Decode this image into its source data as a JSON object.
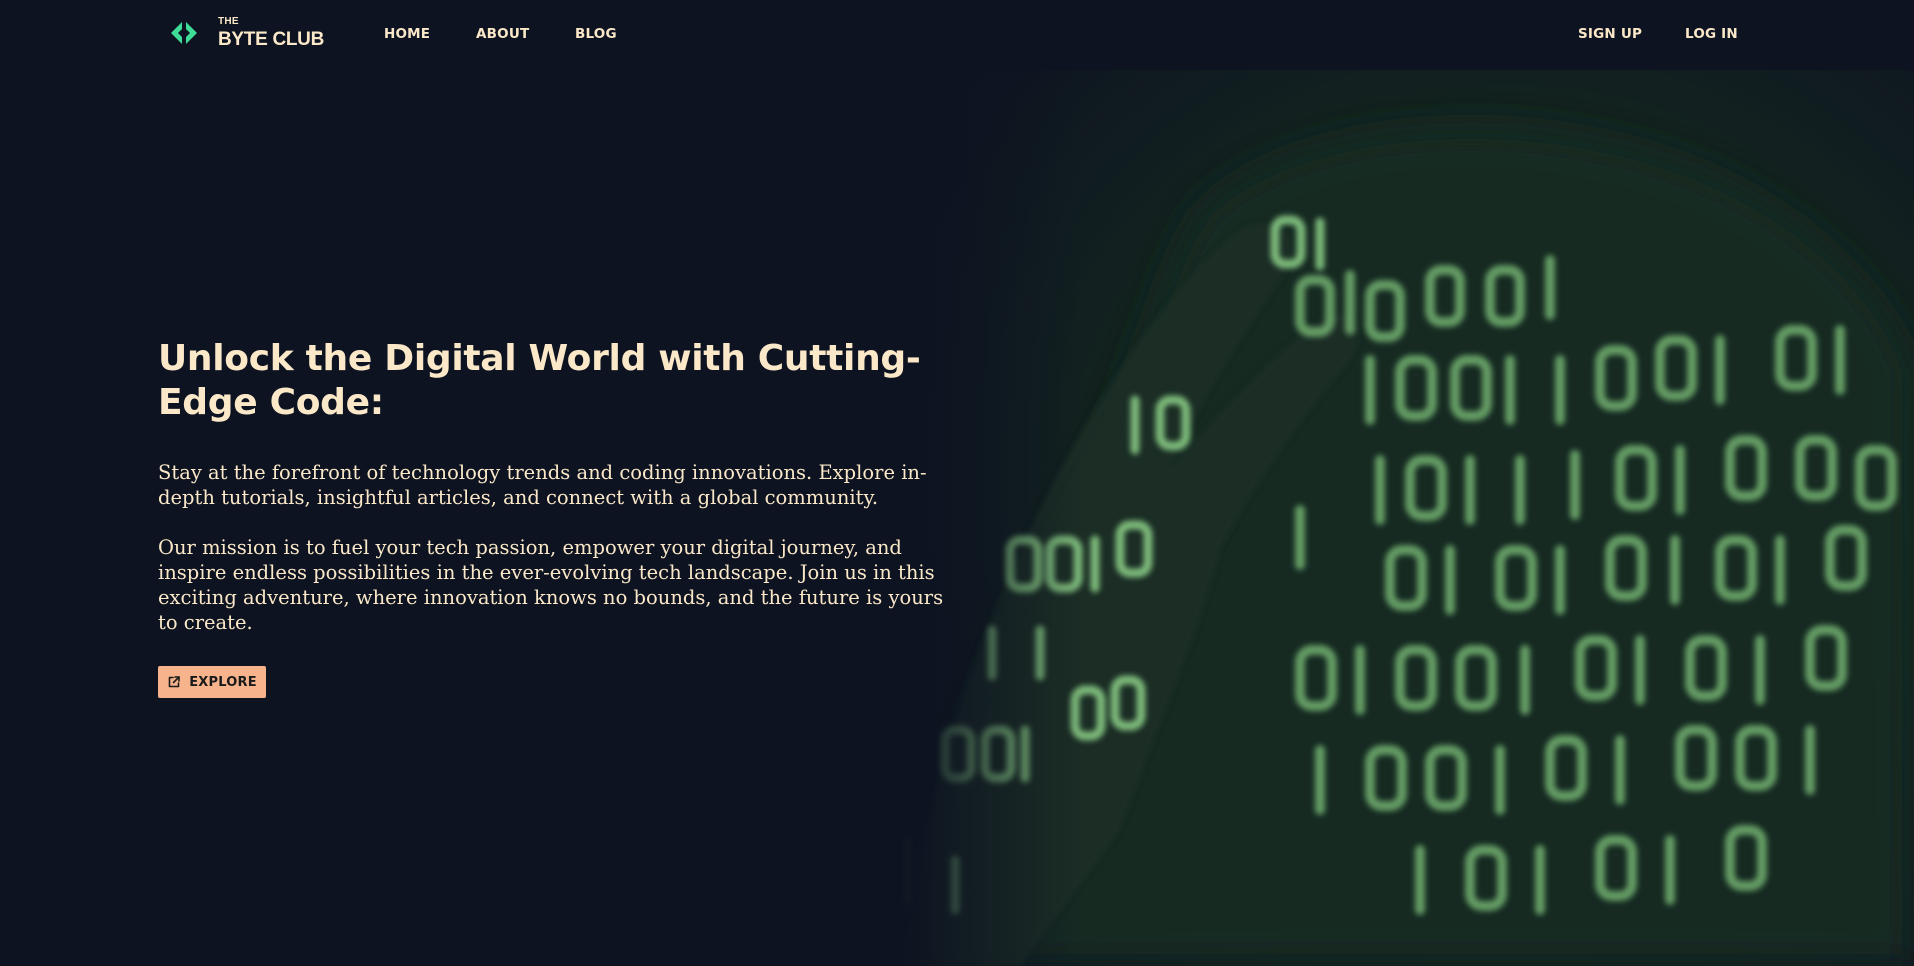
{
  "brand": {
    "small": "THE",
    "name": "BYTE CLUB",
    "logo_icon": "code-brackets-icon",
    "accent": "#3ddc97"
  },
  "nav": {
    "left": [
      {
        "label": "HOME"
      },
      {
        "label": "ABOUT"
      },
      {
        "label": "BLOG"
      }
    ],
    "right": [
      {
        "label": "SIGN UP"
      },
      {
        "label": "LOG IN"
      }
    ]
  },
  "hero": {
    "title": "Unlock the Digital World with Cutting-Edge Code:",
    "paragraph1": "Stay at the forefront of technology trends and coding innovations. Explore in-depth tutorials, insightful articles, and connect with a global community.",
    "paragraph2": "Our mission is to fuel your tech passion, empower your digital journey, and inspire endless possibilities in the ever-evolving tech landscape. Join us in this exciting adventure, where innovation knows no bounds, and the future is yours to create.",
    "cta": {
      "label": "EXPLORE",
      "icon": "external-link-icon"
    }
  },
  "colors": {
    "background": "#0d1321",
    "text": "#fbe8c8",
    "cta_background": "#f7b38c",
    "code_green": "#8fd48a"
  }
}
